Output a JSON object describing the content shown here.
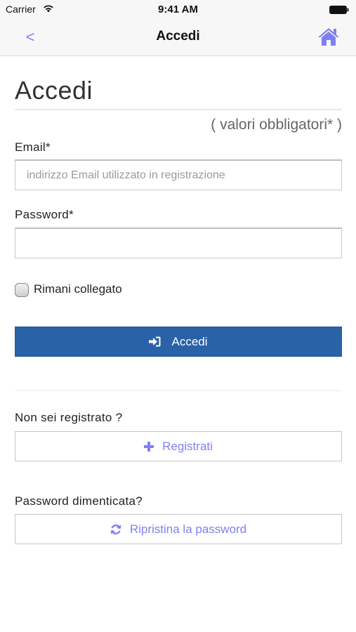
{
  "status_bar": {
    "carrier": "Carrier",
    "time": "9:41 AM"
  },
  "nav": {
    "back_label": "<",
    "title": "Accedi",
    "home_icon": "home-icon"
  },
  "form": {
    "title": "Accedi",
    "required_note": "( valori obbligatori* )",
    "email": {
      "label": "Email*",
      "value": "",
      "placeholder": "indirizzo Email utilizzato in registrazione"
    },
    "password": {
      "label": "Password*",
      "value": "",
      "placeholder": ""
    },
    "remember": {
      "label": "Rimani collegato",
      "checked": false
    },
    "login_button": "Accedi"
  },
  "register": {
    "prompt": "Non sei registrato ?",
    "button": "Registrati"
  },
  "forgot": {
    "prompt": "Password dimenticata?",
    "button": "Ripristina la password"
  },
  "colors": {
    "accent": "#7f7ff5",
    "primary_button": "#2962a7"
  }
}
